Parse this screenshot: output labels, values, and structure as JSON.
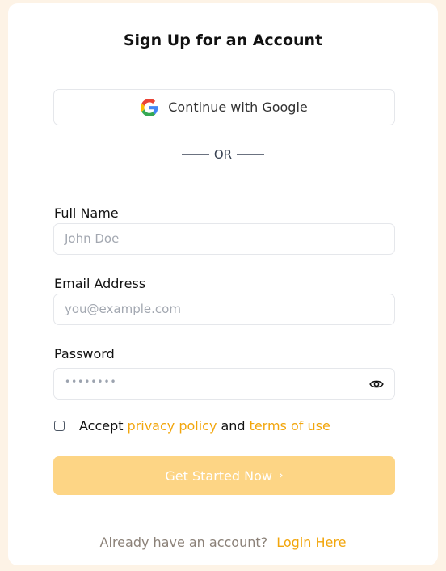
{
  "form": {
    "title": "Sign Up for an Account",
    "google_button_label": "Continue with Google",
    "divider_text": "OR",
    "full_name": {
      "label": "Full Name",
      "placeholder": "John Doe"
    },
    "email": {
      "label": "Email Address",
      "placeholder": "you@example.com"
    },
    "password": {
      "label": "Password",
      "masked_value": "••••••••"
    },
    "terms": {
      "prefix": "Accept",
      "privacy_link": "privacy policy",
      "conjunction": "and",
      "terms_link": "terms of use"
    },
    "submit_label": "Get Started Now",
    "submit_chevron": "›",
    "footer_text": "Already have an account?",
    "login_link": "Login Here"
  },
  "colors": {
    "accent": "#f2a60d",
    "cta_bg": "#fdd585",
    "page_bg": "#fdf3e6"
  },
  "icons": [
    "google-logo-icon",
    "eye-icon"
  ]
}
